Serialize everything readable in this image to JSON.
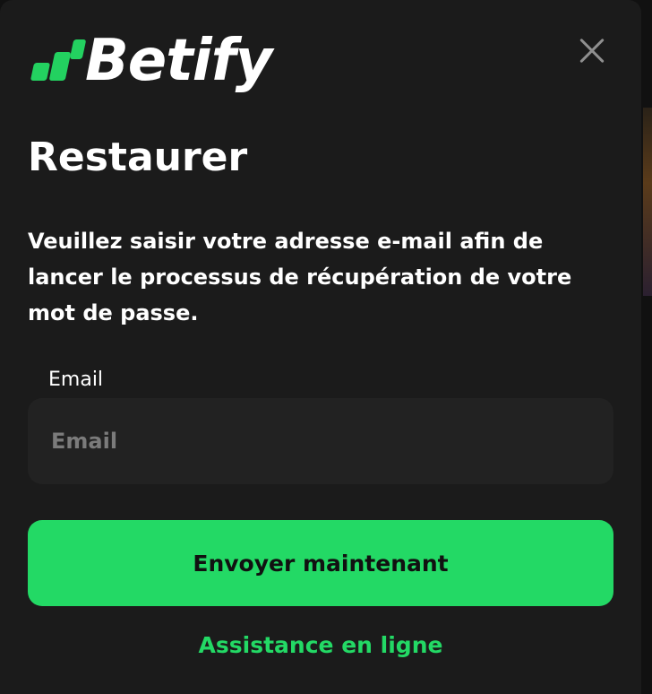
{
  "brand": {
    "name": "Betify",
    "accent_color": "#23d965"
  },
  "header": {
    "close_icon": "close-icon"
  },
  "form": {
    "title": "Restaurer",
    "description": "Veuillez saisir votre adresse e-mail afin de lancer le processus de récupération de votre mot de passe.",
    "email_label": "Email",
    "email_placeholder": "Email",
    "email_value": "",
    "submit_label": "Envoyer maintenant",
    "support_label": "Assistance en ligne"
  }
}
